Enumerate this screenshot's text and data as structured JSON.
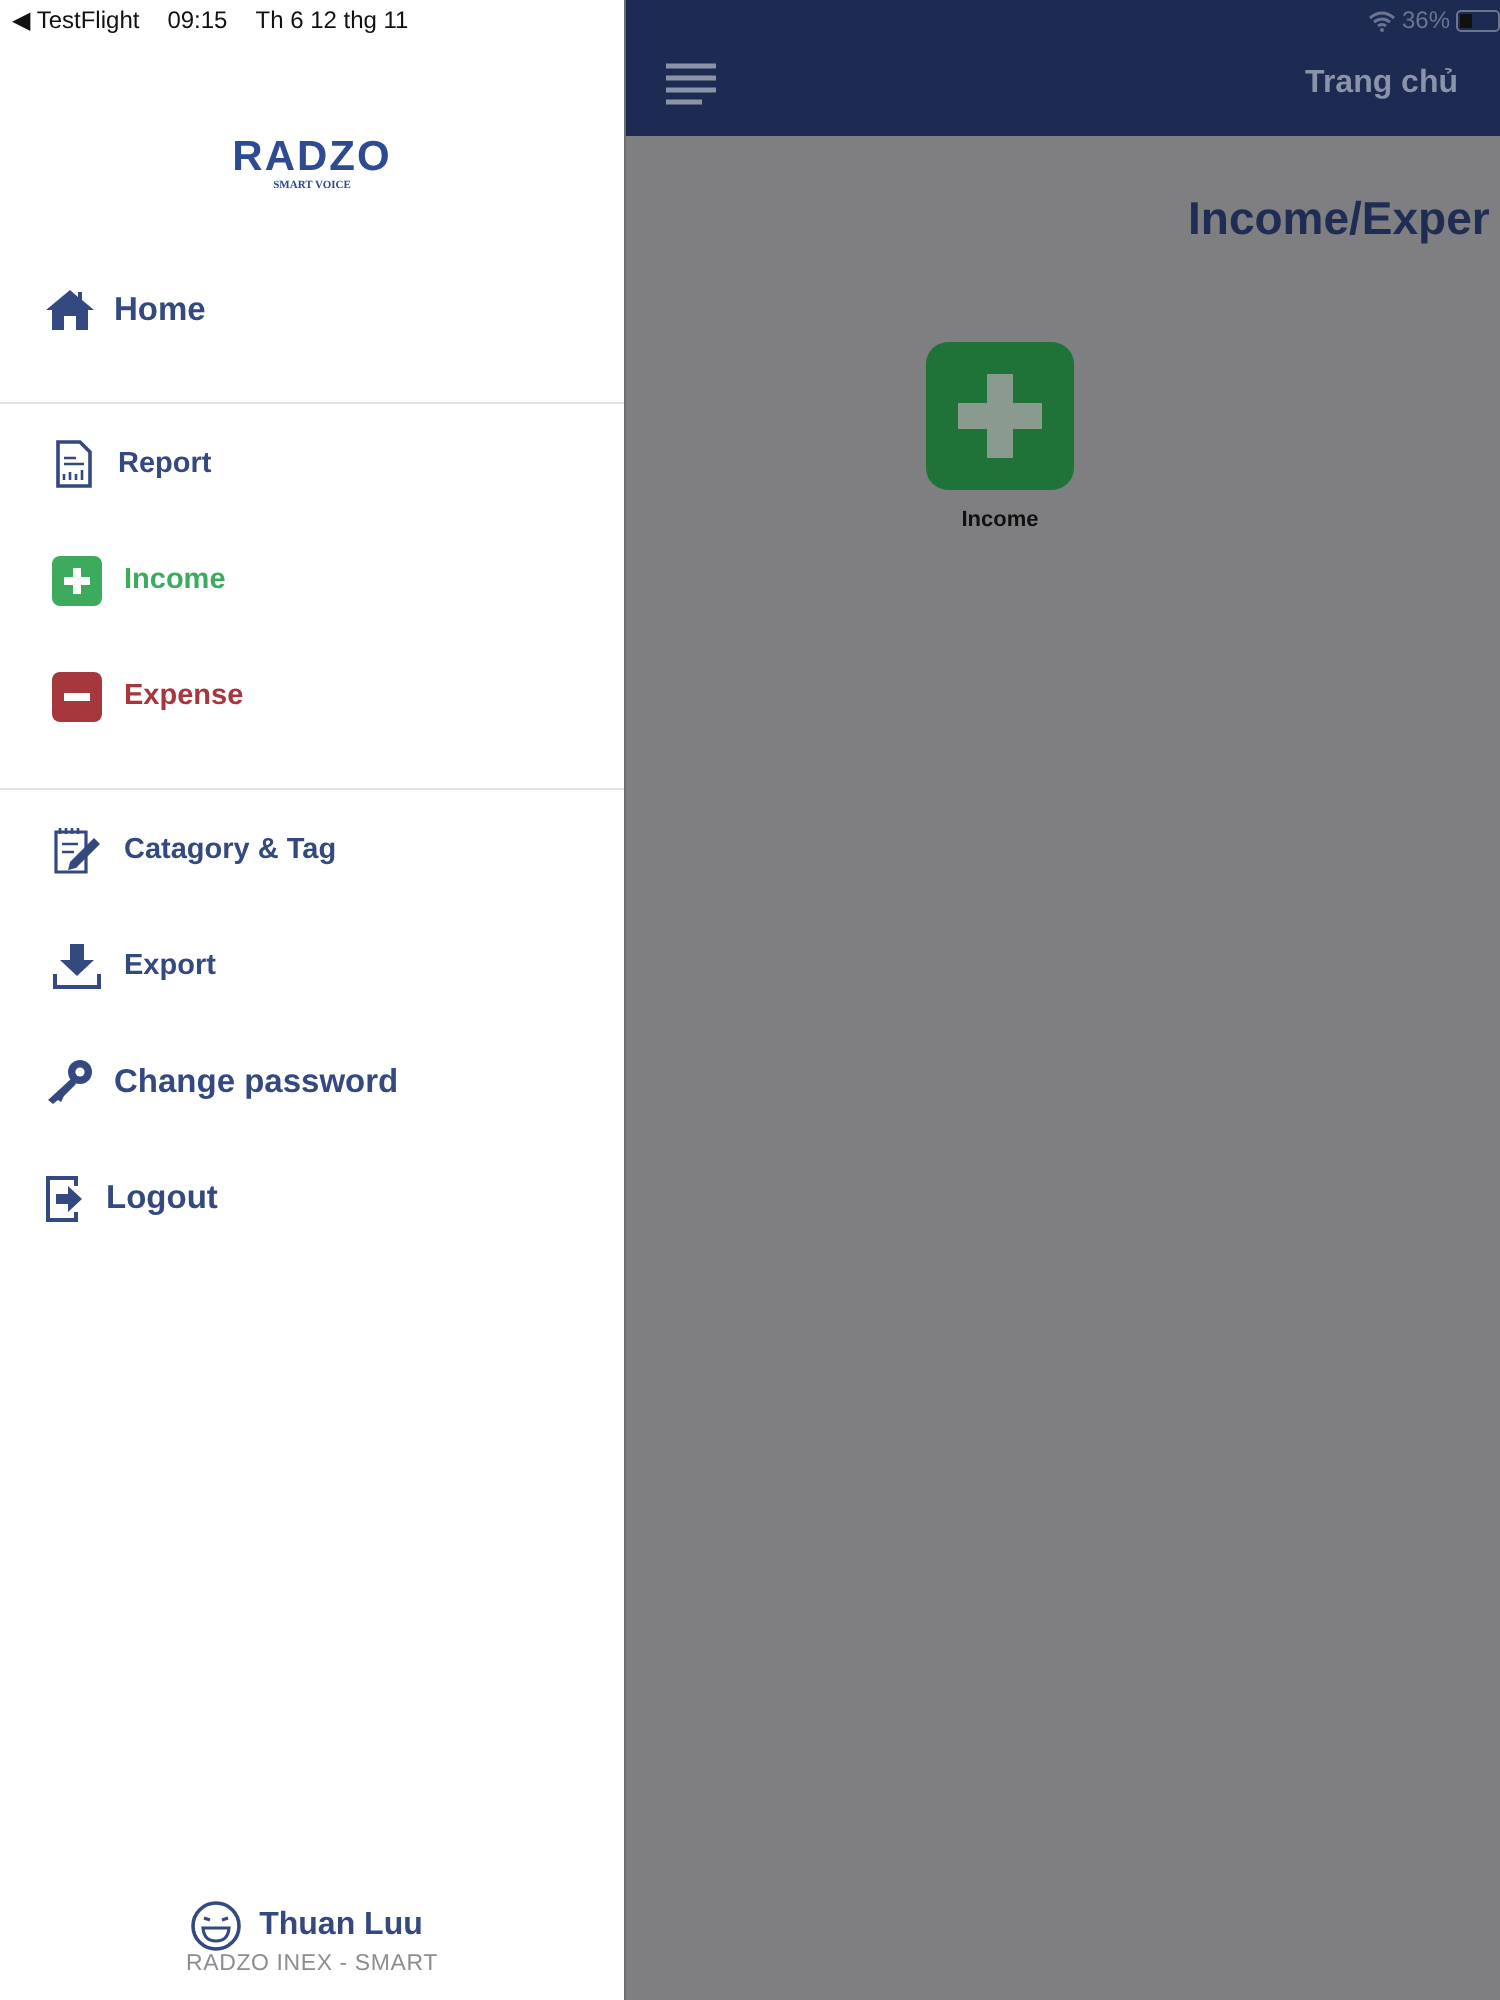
{
  "status_bar": {
    "back": "◀ TestFlight",
    "time": "09:15",
    "date": "Th 6 12 thg 11",
    "battery": "36%"
  },
  "drawer": {
    "logo": {
      "name": "RADZO",
      "tagline": "SMART VOICE"
    },
    "groups": [
      {
        "items": [
          {
            "kind": "home",
            "label": "Home"
          }
        ]
      },
      {
        "items": [
          {
            "kind": "report",
            "label": "Report"
          },
          {
            "kind": "income",
            "label": "Income",
            "color": "#3dab5e"
          },
          {
            "kind": "expense",
            "label": "Expense",
            "color": "#a6373d"
          }
        ]
      },
      {
        "items": [
          {
            "kind": "category",
            "label": "Catagory & Tag"
          },
          {
            "kind": "export",
            "label": "Export"
          },
          {
            "kind": "key",
            "label": "Change password"
          },
          {
            "kind": "logout",
            "label": "Logout"
          }
        ]
      }
    ],
    "user": {
      "name": "Thuan Luu",
      "subtitle": "RADZO INEX - SMART"
    }
  },
  "header": {
    "title": "Trang chủ"
  },
  "main": {
    "title": "Income/Exper",
    "tiles": [
      {
        "kind": "income",
        "label": "Income"
      }
    ]
  }
}
